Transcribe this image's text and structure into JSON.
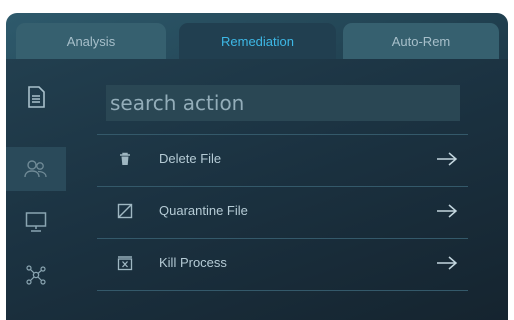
{
  "tabs": [
    {
      "label": "Analysis"
    },
    {
      "label": "Remediation"
    },
    {
      "label": "Auto-Rem"
    }
  ],
  "active_tab": "Remediation",
  "sidebar": {
    "items": [
      {
        "icon": "document-icon"
      },
      {
        "icon": "users-icon"
      },
      {
        "icon": "monitor-icon"
      },
      {
        "icon": "network-icon"
      }
    ],
    "active_index": 1
  },
  "search": {
    "placeholder": "search action",
    "value": ""
  },
  "actions": [
    {
      "label": "Delete File",
      "icon": "trash-icon"
    },
    {
      "label": "Quarantine File",
      "icon": "quarantine-icon"
    },
    {
      "label": "Kill Process",
      "icon": "kill-process-icon"
    }
  ],
  "colors": {
    "accent": "#3db8e6",
    "panel": "#1b3241",
    "tab_inactive": "#36606f",
    "text": "#b5cbd5"
  }
}
